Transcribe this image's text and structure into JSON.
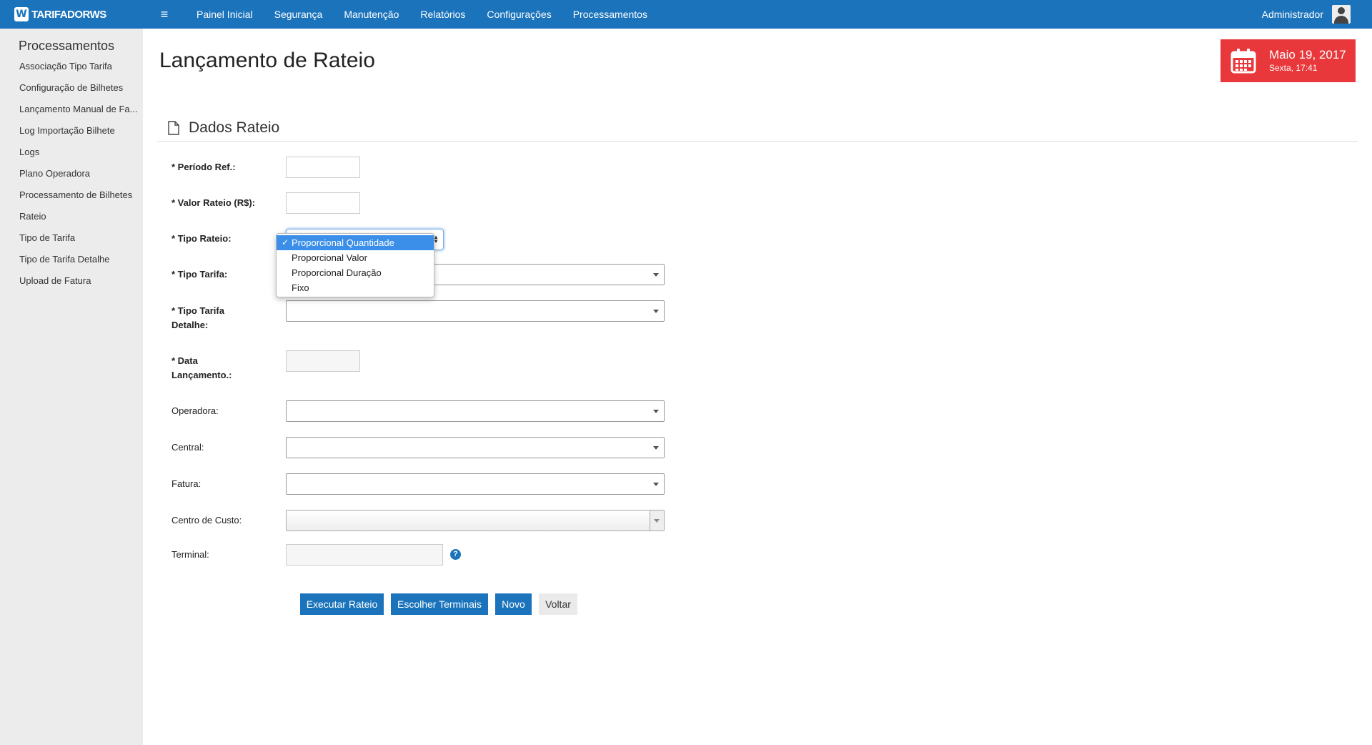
{
  "topbar": {
    "brand": "TARIFADORWS",
    "nav": [
      "Painel Inicial",
      "Segurança",
      "Manutenção",
      "Relatórios",
      "Configurações",
      "Processamentos"
    ],
    "user": "Administrador"
  },
  "sidebar": {
    "title": "Processamentos",
    "items": [
      "Associação Tipo Tarifa",
      "Configuração de Bilhetes",
      "Lançamento Manual de Fa...",
      "Log Importação Bilhete",
      "Logs",
      "Plano Operadora",
      "Processamento de Bilhetes",
      "Rateio",
      "Tipo de Tarifa",
      "Tipo de Tarifa Detalhe",
      "Upload de Fatura"
    ]
  },
  "page": {
    "title": "Lançamento de Rateio"
  },
  "date": {
    "main": "Maio 19, 2017",
    "sub": "Sexta, 17:41"
  },
  "section": {
    "title": "Dados Rateio"
  },
  "form": {
    "periodo": "* Período Ref.:",
    "valor": "* Valor Rateio (R$):",
    "tipo_rateio": "* Tipo Rateio:",
    "tipo_tarifa": "* Tipo Tarifa:",
    "tipo_tarifa_detalhe_1": "* Tipo Tarifa",
    "tipo_tarifa_detalhe_2": "Detalhe:",
    "data_lanc_1": "* Data",
    "data_lanc_2": "Lançamento.:",
    "operadora": "Operadora:",
    "central": "Central:",
    "fatura": "Fatura:",
    "centro_custo": "Centro de Custo:",
    "terminal": "Terminal:"
  },
  "dropdown": {
    "check": "✓",
    "options": [
      "Proporcional Quantidade",
      "Proporcional Valor",
      "Proporcional Duração",
      "Fixo"
    ]
  },
  "buttons": {
    "executar": "Executar Rateio",
    "escolher": "Escolher Terminais",
    "novo": "Novo",
    "voltar": "Voltar"
  },
  "help": "?",
  "colors": {
    "primary": "#1a73bb",
    "date_bg": "#e8383b",
    "sidebar_bg": "#ececec",
    "selected_option": "#3b8fe8"
  }
}
